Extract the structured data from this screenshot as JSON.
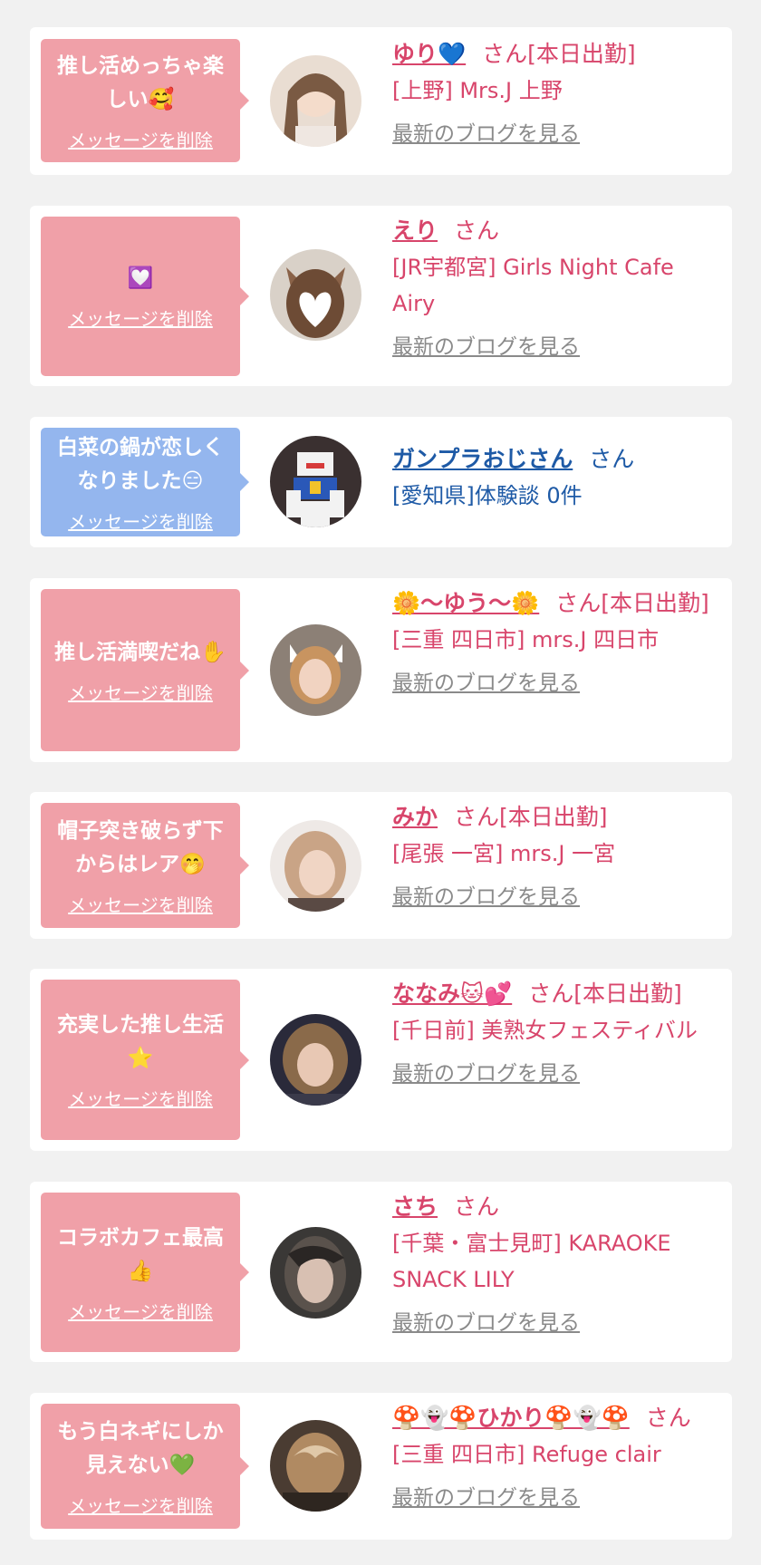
{
  "colors": {
    "page_bg": "#f1f1f1",
    "card_bg": "#ffffff",
    "bubble_pink": "#f0a0a8",
    "bubble_blue": "#94b6ee",
    "name_pink": "#d8456b",
    "name_blue": "#1e5aa6",
    "link_gray": "#8a8a8a"
  },
  "delete_label": "メッセージを削除",
  "blog_label": "最新のブログを見る",
  "items": [
    {
      "message": "推し活めっちゃ楽\nしい🥰",
      "name": "ゆり💙",
      "suffix": "さん[本日出勤]",
      "shop": "[上野] Mrs.J 上野"
    },
    {
      "message": "💟",
      "name": "えり",
      "suffix": "さん",
      "shop": "[JR宇都宮] Girls Night Cafe Airy"
    },
    {
      "message": "白菜の鍋が恋しく\nなりました😑",
      "name": "ガンプラおじさん",
      "suffix": "さん",
      "shop": "[愛知県]体験談 0件"
    },
    {
      "message": "推し活満喫だね✋",
      "name": "🌼〜ゆう〜🌼",
      "suffix": "さん[本日出勤]",
      "shop": "[三重 四日市] mrs.J 四日市"
    },
    {
      "message": "帽子突き破らず下\nからはレア🤭",
      "name": "みか",
      "suffix": "さん[本日出勤]",
      "shop": "[尾張 一宮] mrs.J 一宮"
    },
    {
      "message": "充実した推し生活\n⭐",
      "name": "ななみ🐱💕",
      "suffix": "さん[本日出勤]",
      "shop": "[千日前] 美熟女フェスティバル"
    },
    {
      "message": "コラボカフェ最高\n👍",
      "name": "さち",
      "suffix": "さん",
      "shop": "[千葉・富士見町] KARAOKE SNACK LILY"
    },
    {
      "message": "もう白ネギにしか\n見えない💚",
      "name": "🍄👻🍄ひかり🍄👻🍄",
      "suffix": "さん",
      "shop": "[三重 四日市] Refuge clair"
    }
  ]
}
